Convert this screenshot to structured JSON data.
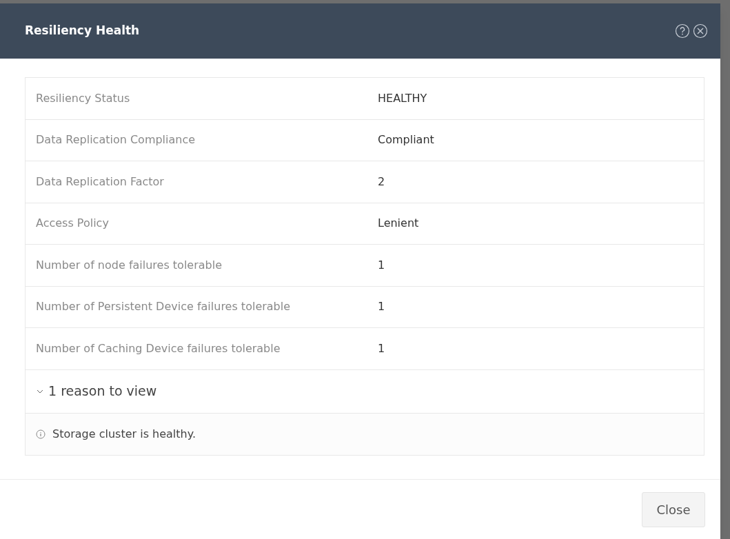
{
  "dialog": {
    "title": "Resiliency Health",
    "rows": [
      {
        "label": "Resiliency Status",
        "value": "HEALTHY"
      },
      {
        "label": "Data Replication Compliance",
        "value": "Compliant"
      },
      {
        "label": "Data Replication Factor",
        "value": "2"
      },
      {
        "label": "Access Policy",
        "value": "Lenient"
      },
      {
        "label": "Number of node failures tolerable",
        "value": "1"
      },
      {
        "label": "Number of Persistent Device failures tolerable",
        "value": "1"
      },
      {
        "label": "Number of Caching Device failures tolerable",
        "value": "1"
      }
    ],
    "reasons": {
      "label": "1 reason to view",
      "expanded": true,
      "items": [
        "Storage cluster is healthy."
      ]
    },
    "buttons": [
      "Close"
    ]
  }
}
